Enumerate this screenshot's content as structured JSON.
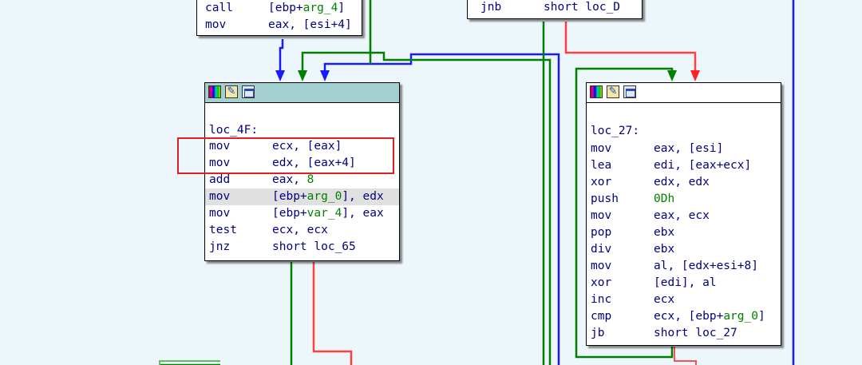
{
  "top_left_block": {
    "lines": [
      {
        "mnemonic": "call",
        "pre": "[ebp+",
        "sym": "arg_4",
        "post": "]"
      },
      {
        "mnemonic": "mov",
        "pre": "eax, [esi+4]",
        "sym": "",
        "post": ""
      }
    ]
  },
  "top_right_block": {
    "lines": [
      {
        "mnemonic": "jnb",
        "pre": "short loc_D",
        "sym": "",
        "post": ""
      }
    ]
  },
  "block_loc_4f": {
    "label": "loc_4F:",
    "lines": [
      {
        "mnemonic": "mov",
        "pre": "ecx, [eax]",
        "sym": "",
        "post": ""
      },
      {
        "mnemonic": "mov",
        "pre": "edx, [eax+4]",
        "sym": "",
        "post": ""
      },
      {
        "mnemonic": "add",
        "pre": "eax, ",
        "sym": "8",
        "post": ""
      },
      {
        "mnemonic": "mov",
        "pre": "[ebp+",
        "sym": "arg_0",
        "post": "], edx"
      },
      {
        "mnemonic": "mov",
        "pre": "[ebp+",
        "sym": "var_4",
        "post": "], eax"
      },
      {
        "mnemonic": "test",
        "pre": "ecx, ecx",
        "sym": "",
        "post": ""
      },
      {
        "mnemonic": "jnz",
        "pre": "short loc_65",
        "sym": "",
        "post": ""
      }
    ]
  },
  "block_loc_27": {
    "label": "loc_27:",
    "lines": [
      {
        "mnemonic": "mov",
        "pre": "eax, [esi]",
        "sym": "",
        "post": ""
      },
      {
        "mnemonic": "lea",
        "pre": "edi, [eax+ecx]",
        "sym": "",
        "post": ""
      },
      {
        "mnemonic": "xor",
        "pre": "edx, edx",
        "sym": "",
        "post": ""
      },
      {
        "mnemonic": "push",
        "pre": "",
        "sym": "0Dh",
        "post": ""
      },
      {
        "mnemonic": "mov",
        "pre": "eax, ecx",
        "sym": "",
        "post": ""
      },
      {
        "mnemonic": "pop",
        "pre": "ebx",
        "sym": "",
        "post": ""
      },
      {
        "mnemonic": "div",
        "pre": "ebx",
        "sym": "",
        "post": ""
      },
      {
        "mnemonic": "mov",
        "pre": "al, [edx+esi+8]",
        "sym": "",
        "post": ""
      },
      {
        "mnemonic": "xor",
        "pre": "[edi], al",
        "sym": "",
        "post": ""
      },
      {
        "mnemonic": "inc",
        "pre": "ecx",
        "sym": "",
        "post": ""
      },
      {
        "mnemonic": "cmp",
        "pre": "ecx, [ebp+",
        "sym": "arg_0",
        "post": "]"
      },
      {
        "mnemonic": "jb",
        "pre": "short loc_27",
        "sym": "",
        "post": ""
      }
    ]
  },
  "icons": [
    "color-palette-icon",
    "rename-icon",
    "graph-view-icon"
  ],
  "colors": {
    "background": "#ecf6fb",
    "edge_true": "#008000",
    "edge_false": "#ff0000",
    "edge_unconditional": "#0000ff",
    "active_header": "#a3d1d1",
    "highlight_box": "#e02020",
    "code_text": "#000080",
    "symbol_text": "#008000"
  }
}
